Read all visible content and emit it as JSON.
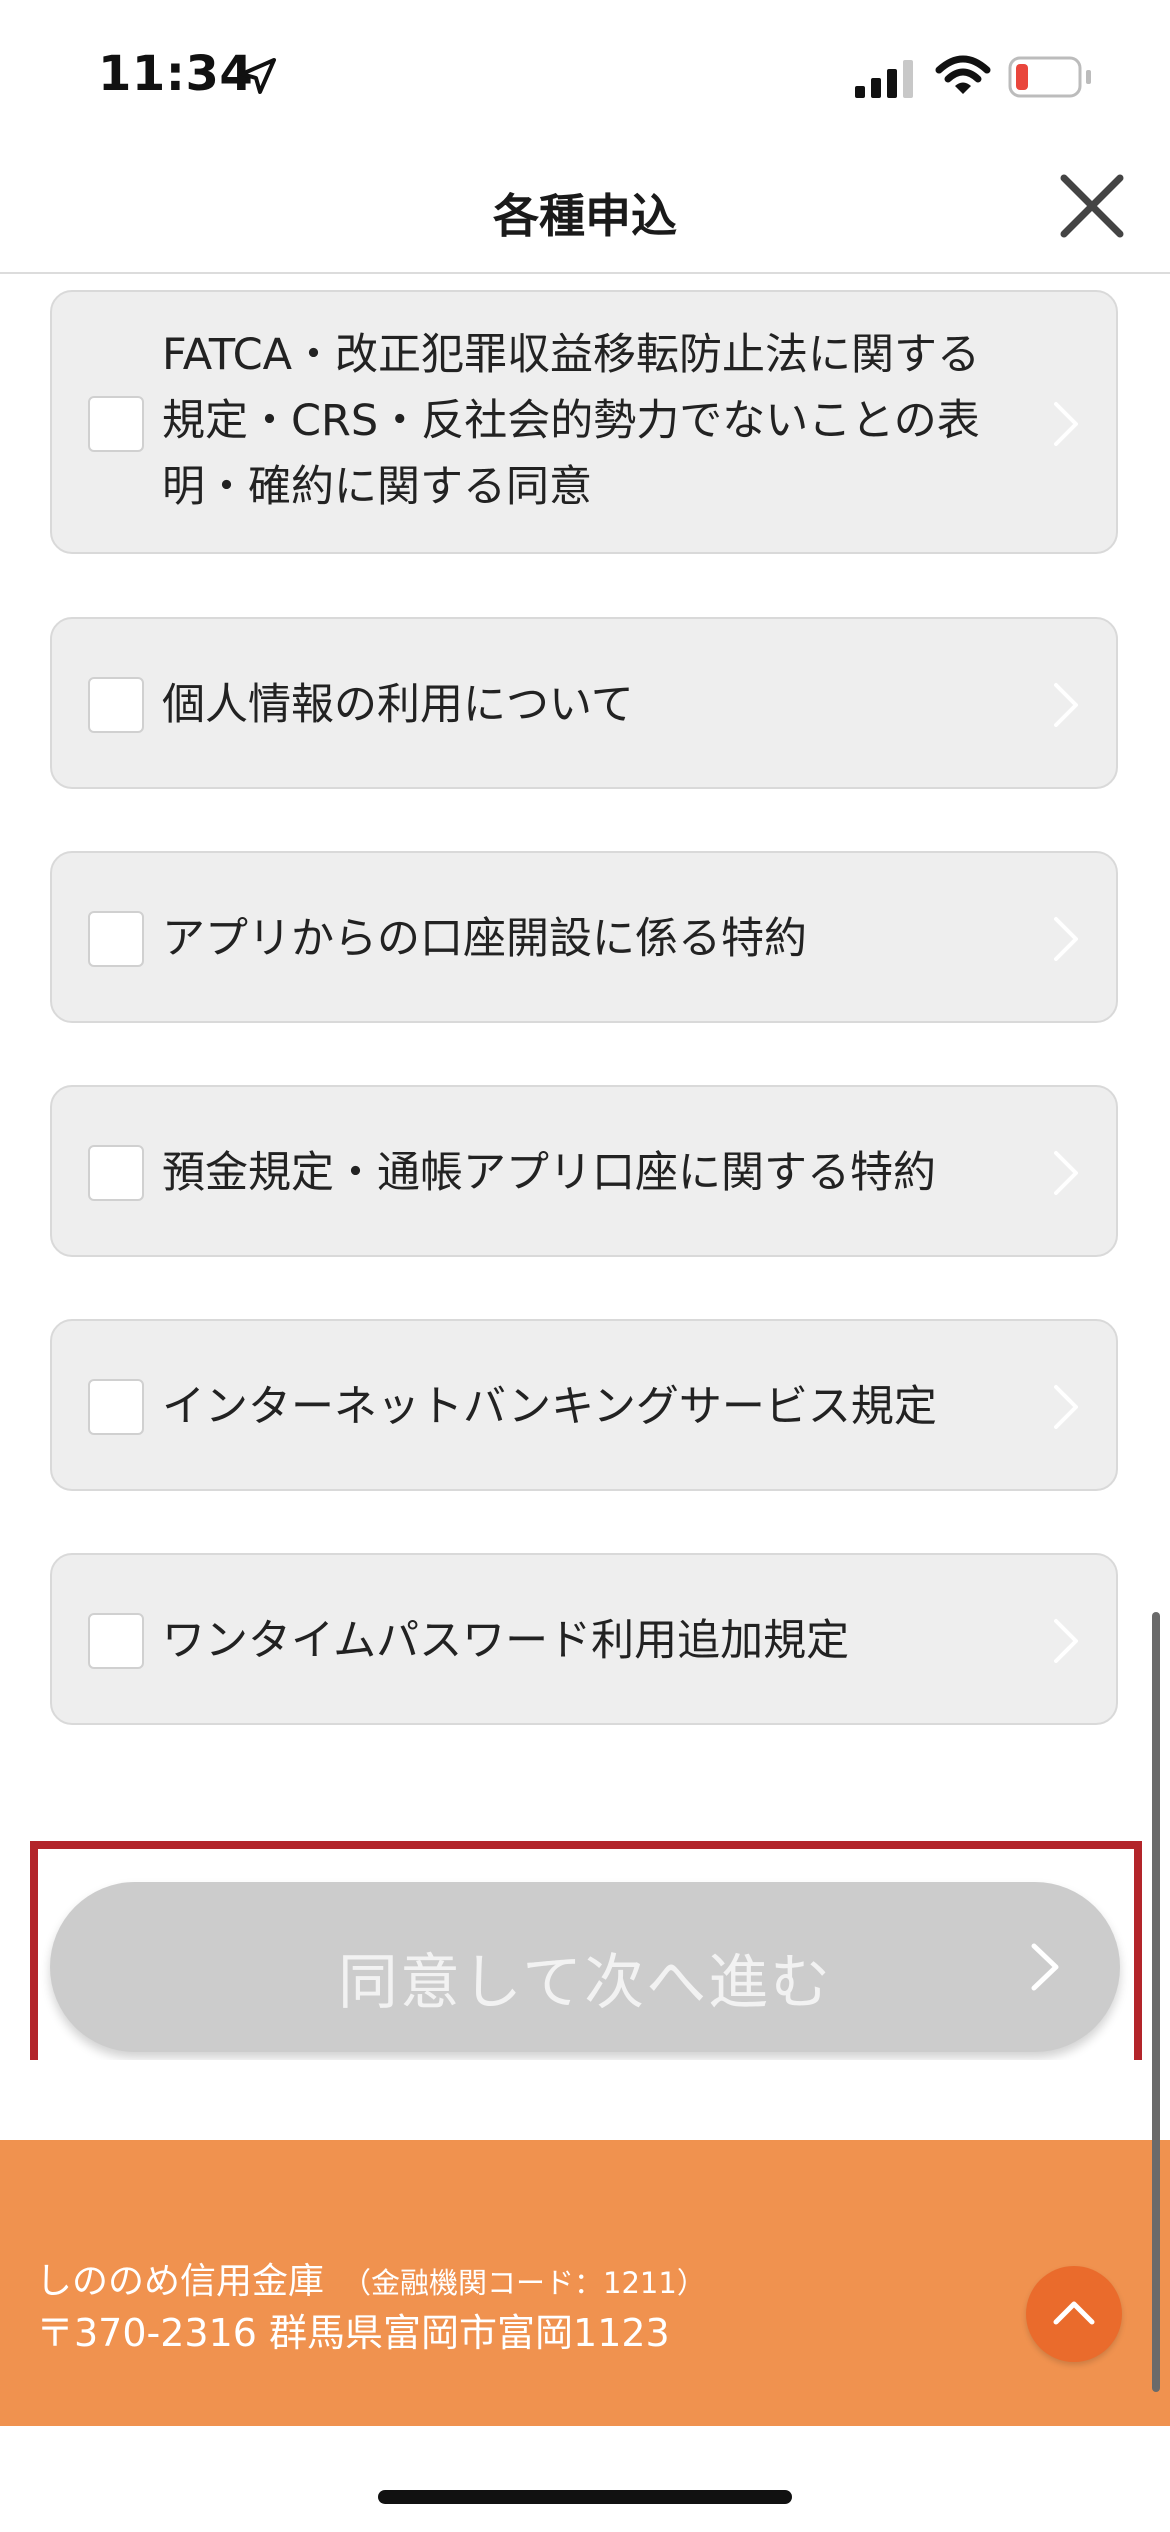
{
  "status_bar": {
    "time": "11:34",
    "icons": [
      "location-arrow-icon",
      "cellular-signal-icon",
      "wifi-icon",
      "battery-low-icon"
    ],
    "battery_color": "#e9463c"
  },
  "header": {
    "title": "各種申込",
    "close_icon": "close-icon"
  },
  "agreements": [
    {
      "label": "FATCA・改正犯罪収益移転防止法に関する規定・CRS・反社会的勢力でないことの表明・確約に関する同意",
      "checked": false
    },
    {
      "label": "個人情報の利用について",
      "checked": false
    },
    {
      "label": "アプリからの口座開設に係る特約",
      "checked": false
    },
    {
      "label": "預金規定・通帳アプリ口座に関する特約",
      "checked": false
    },
    {
      "label": "インターネットバンキングサービス規定",
      "checked": false
    },
    {
      "label": "ワンタイムパスワード利用追加規定",
      "checked": false
    }
  ],
  "submit": {
    "label": "同意して次へ進む",
    "state": "disabled",
    "highlight_color": "#b3252a"
  },
  "footer": {
    "bank_name": "しののめ信用金庫",
    "institution_code": "（金融機関コード：1211）",
    "address": "〒370-2316 群馬県富岡市富岡1123",
    "background": "#f0924f",
    "top_button_icon": "chevron-up-icon"
  }
}
